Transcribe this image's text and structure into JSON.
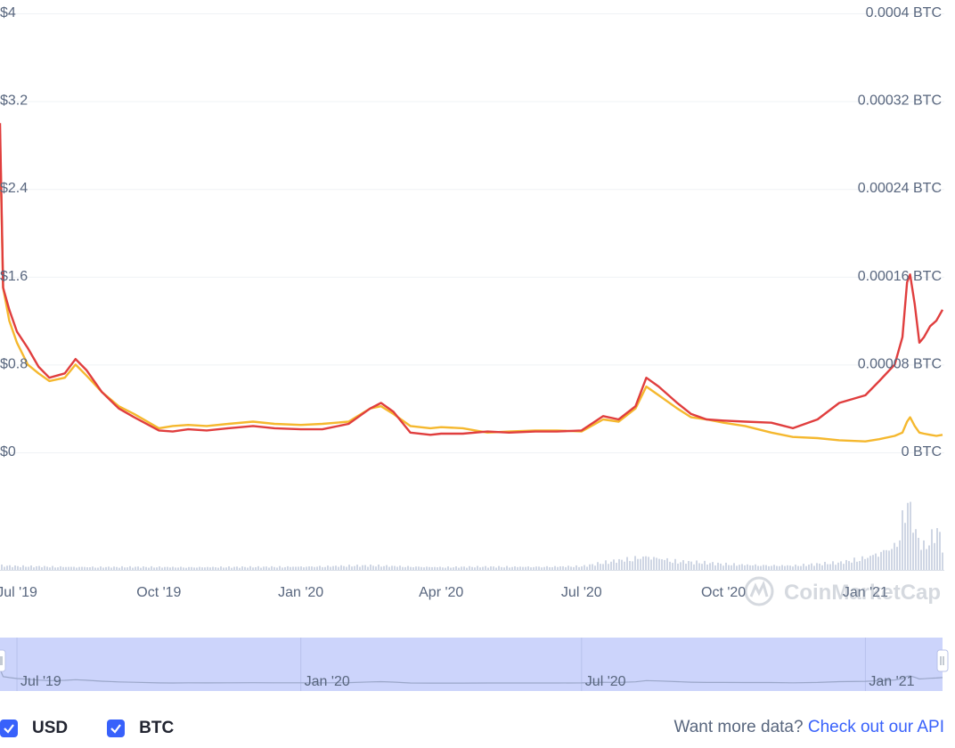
{
  "chart_data": {
    "type": "line",
    "x_range": [
      "2019-06-20",
      "2021-02-20"
    ],
    "left_axis": {
      "ticks": [
        "$0",
        "$0.8",
        "$1.6",
        "$2.4",
        "$3.2",
        "$4"
      ],
      "ylim": [
        0,
        4
      ]
    },
    "right_axis": {
      "ticks": [
        "0 BTC",
        "0.00008 BTC",
        "0.00016 BTC",
        "0.00024 BTC",
        "0.00032 BTC",
        "0.0004 BTC"
      ],
      "ylim": [
        0,
        0.0004
      ]
    },
    "x_ticks": [
      {
        "date": "2019-07-01",
        "label": "Jul '19"
      },
      {
        "date": "2019-10-01",
        "label": "Oct '19"
      },
      {
        "date": "2020-01-01",
        "label": "Jan '20"
      },
      {
        "date": "2020-04-01",
        "label": "Apr '20"
      },
      {
        "date": "2020-07-01",
        "label": "Jul '20"
      },
      {
        "date": "2020-10-01",
        "label": "Oct '20"
      },
      {
        "date": "2021-01-01",
        "label": "Jan '21"
      }
    ],
    "navigator_ticks": [
      {
        "date": "2019-07-01",
        "label": "Jul '19"
      },
      {
        "date": "2020-01-01",
        "label": "Jan '20"
      },
      {
        "date": "2020-07-01",
        "label": "Jul '20"
      },
      {
        "date": "2021-01-01",
        "label": "Jan '21"
      }
    ],
    "series": [
      {
        "name": "USD",
        "axis": "left",
        "color": "#e03e3e",
        "points": [
          [
            "2019-06-20",
            3.0
          ],
          [
            "2019-06-22",
            1.5
          ],
          [
            "2019-06-26",
            1.3
          ],
          [
            "2019-07-01",
            1.1
          ],
          [
            "2019-07-08",
            0.95
          ],
          [
            "2019-07-15",
            0.78
          ],
          [
            "2019-07-22",
            0.68
          ],
          [
            "2019-08-01",
            0.72
          ],
          [
            "2019-08-08",
            0.85
          ],
          [
            "2019-08-15",
            0.75
          ],
          [
            "2019-08-25",
            0.55
          ],
          [
            "2019-09-05",
            0.4
          ],
          [
            "2019-09-15",
            0.32
          ],
          [
            "2019-10-01",
            0.2
          ],
          [
            "2019-10-10",
            0.19
          ],
          [
            "2019-10-20",
            0.21
          ],
          [
            "2019-11-01",
            0.2
          ],
          [
            "2019-11-15",
            0.22
          ],
          [
            "2019-12-01",
            0.24
          ],
          [
            "2019-12-15",
            0.22
          ],
          [
            "2020-01-01",
            0.21
          ],
          [
            "2020-01-15",
            0.21
          ],
          [
            "2020-02-01",
            0.26
          ],
          [
            "2020-02-15",
            0.4
          ],
          [
            "2020-02-22",
            0.45
          ],
          [
            "2020-03-01",
            0.37
          ],
          [
            "2020-03-12",
            0.18
          ],
          [
            "2020-03-25",
            0.16
          ],
          [
            "2020-04-01",
            0.17
          ],
          [
            "2020-04-15",
            0.17
          ],
          [
            "2020-05-01",
            0.19
          ],
          [
            "2020-05-15",
            0.18
          ],
          [
            "2020-06-01",
            0.19
          ],
          [
            "2020-06-15",
            0.19
          ],
          [
            "2020-07-01",
            0.2
          ],
          [
            "2020-07-15",
            0.33
          ],
          [
            "2020-07-25",
            0.3
          ],
          [
            "2020-08-05",
            0.42
          ],
          [
            "2020-08-12",
            0.68
          ],
          [
            "2020-08-20",
            0.6
          ],
          [
            "2020-09-01",
            0.45
          ],
          [
            "2020-09-10",
            0.35
          ],
          [
            "2020-09-20",
            0.3
          ],
          [
            "2020-10-01",
            0.29
          ],
          [
            "2020-10-15",
            0.28
          ],
          [
            "2020-11-01",
            0.27
          ],
          [
            "2020-11-15",
            0.22
          ],
          [
            "2020-12-01",
            0.3
          ],
          [
            "2020-12-15",
            0.45
          ],
          [
            "2021-01-01",
            0.52
          ],
          [
            "2021-01-10",
            0.65
          ],
          [
            "2021-01-20",
            0.8
          ],
          [
            "2021-01-25",
            1.05
          ],
          [
            "2021-01-28",
            1.55
          ],
          [
            "2021-01-30",
            1.62
          ],
          [
            "2021-02-02",
            1.35
          ],
          [
            "2021-02-05",
            1.0
          ],
          [
            "2021-02-08",
            1.05
          ],
          [
            "2021-02-12",
            1.15
          ],
          [
            "2021-02-16",
            1.2
          ],
          [
            "2021-02-20",
            1.3
          ]
        ]
      },
      {
        "name": "BTC",
        "axis": "right",
        "color": "#f5b82e",
        "points": [
          [
            "2019-06-20",
            0.00029
          ],
          [
            "2019-06-22",
            0.00015
          ],
          [
            "2019-06-26",
            0.00012
          ],
          [
            "2019-07-01",
            0.0001
          ],
          [
            "2019-07-08",
            8e-05
          ],
          [
            "2019-07-15",
            7.2e-05
          ],
          [
            "2019-07-22",
            6.5e-05
          ],
          [
            "2019-08-01",
            6.8e-05
          ],
          [
            "2019-08-08",
            8e-05
          ],
          [
            "2019-08-15",
            7e-05
          ],
          [
            "2019-08-25",
            5.5e-05
          ],
          [
            "2019-09-05",
            4.2e-05
          ],
          [
            "2019-09-15",
            3.5e-05
          ],
          [
            "2019-10-01",
            2.2e-05
          ],
          [
            "2019-10-10",
            2.4e-05
          ],
          [
            "2019-10-20",
            2.5e-05
          ],
          [
            "2019-11-01",
            2.4e-05
          ],
          [
            "2019-11-15",
            2.6e-05
          ],
          [
            "2019-12-01",
            2.8e-05
          ],
          [
            "2019-12-15",
            2.6e-05
          ],
          [
            "2020-01-01",
            2.5e-05
          ],
          [
            "2020-01-15",
            2.6e-05
          ],
          [
            "2020-02-01",
            2.8e-05
          ],
          [
            "2020-02-15",
            4e-05
          ],
          [
            "2020-02-22",
            4.2e-05
          ],
          [
            "2020-03-01",
            3.5e-05
          ],
          [
            "2020-03-12",
            2.4e-05
          ],
          [
            "2020-03-25",
            2.2e-05
          ],
          [
            "2020-04-01",
            2.3e-05
          ],
          [
            "2020-04-15",
            2.2e-05
          ],
          [
            "2020-05-01",
            1.8e-05
          ],
          [
            "2020-05-15",
            1.9e-05
          ],
          [
            "2020-06-01",
            2e-05
          ],
          [
            "2020-06-15",
            2e-05
          ],
          [
            "2020-07-01",
            1.9e-05
          ],
          [
            "2020-07-15",
            3e-05
          ],
          [
            "2020-07-25",
            2.8e-05
          ],
          [
            "2020-08-05",
            4e-05
          ],
          [
            "2020-08-12",
            6e-05
          ],
          [
            "2020-08-20",
            5.2e-05
          ],
          [
            "2020-09-01",
            4e-05
          ],
          [
            "2020-09-10",
            3.2e-05
          ],
          [
            "2020-09-20",
            3e-05
          ],
          [
            "2020-10-01",
            2.7e-05
          ],
          [
            "2020-10-15",
            2.4e-05
          ],
          [
            "2020-11-01",
            1.8e-05
          ],
          [
            "2020-11-15",
            1.4e-05
          ],
          [
            "2020-12-01",
            1.3e-05
          ],
          [
            "2020-12-15",
            1.1e-05
          ],
          [
            "2021-01-01",
            1e-05
          ],
          [
            "2021-01-10",
            1.2e-05
          ],
          [
            "2021-01-20",
            1.5e-05
          ],
          [
            "2021-01-25",
            1.8e-05
          ],
          [
            "2021-01-28",
            2.8e-05
          ],
          [
            "2021-01-30",
            3.2e-05
          ],
          [
            "2021-02-02",
            2.4e-05
          ],
          [
            "2021-02-05",
            1.8e-05
          ],
          [
            "2021-02-08",
            1.7e-05
          ],
          [
            "2021-02-12",
            1.6e-05
          ],
          [
            "2021-02-16",
            1.5e-05
          ],
          [
            "2021-02-20",
            1.6e-05
          ]
        ]
      }
    ],
    "volume": {
      "color": "#cfd6e4",
      "points": [
        [
          "2019-06-20",
          0.06
        ],
        [
          "2019-07-01",
          0.05
        ],
        [
          "2019-09-01",
          0.04
        ],
        [
          "2019-12-01",
          0.04
        ],
        [
          "2020-02-15",
          0.06
        ],
        [
          "2020-04-01",
          0.04
        ],
        [
          "2020-07-01",
          0.05
        ],
        [
          "2020-08-12",
          0.2
        ],
        [
          "2020-09-01",
          0.12
        ],
        [
          "2020-10-01",
          0.08
        ],
        [
          "2020-11-15",
          0.06
        ],
        [
          "2020-12-15",
          0.1
        ],
        [
          "2021-01-01",
          0.18
        ],
        [
          "2021-01-20",
          0.35
        ],
        [
          "2021-01-28",
          1.0
        ],
        [
          "2021-02-02",
          0.5
        ],
        [
          "2021-02-08",
          0.3
        ],
        [
          "2021-02-16",
          0.55
        ],
        [
          "2021-02-20",
          0.3
        ]
      ]
    },
    "grid": true,
    "watermark": "CoinMarketCap"
  },
  "legend": [
    {
      "label": "USD"
    },
    {
      "label": "BTC"
    }
  ],
  "cta": {
    "text": "Want more data?",
    "link_text": "Check out our API"
  }
}
